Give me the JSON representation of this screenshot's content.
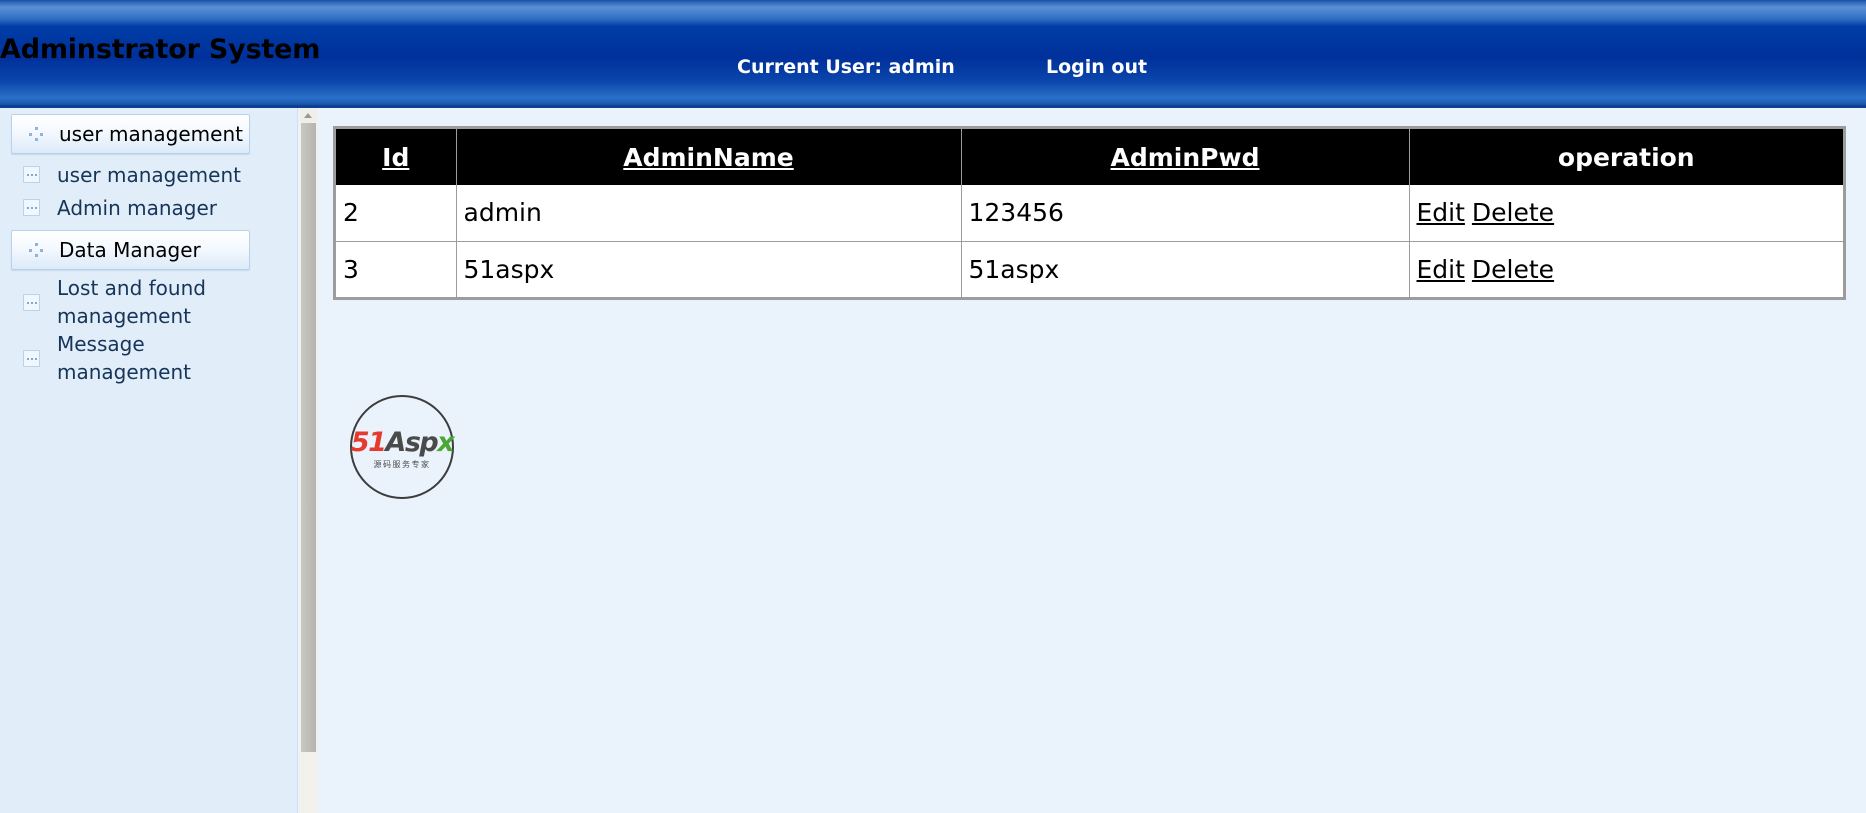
{
  "banner": {
    "title": "Adminstrator System",
    "current_user_label": "Current User:  admin",
    "logout_label": "Login out",
    "gradient_top": "#5a8fd4",
    "gradient_mid": "#00309b",
    "gradient_bottom": "#2a70c8"
  },
  "sidebar": {
    "groups": [
      {
        "label": "user management",
        "icon": "plus-dots-icon",
        "selected": false,
        "items": [
          {
            "label": "user management",
            "icon": "dot-box-icon"
          },
          {
            "label": "Admin manager",
            "icon": "dot-box-icon"
          }
        ]
      },
      {
        "label": "Data Manager",
        "icon": "plus-dots-icon",
        "selected": true,
        "items": [
          {
            "label": "Lost and found management",
            "icon": "dot-box-icon"
          },
          {
            "label": "Message management",
            "icon": "dot-box-icon"
          }
        ]
      }
    ],
    "scrollbar": {
      "up_arrow": "scroll-up-arrow"
    }
  },
  "grid": {
    "columns": [
      {
        "label": "Id",
        "sortable": true
      },
      {
        "label": "AdminName",
        "sortable": true
      },
      {
        "label": "AdminPwd",
        "sortable": true
      },
      {
        "label": "operation",
        "sortable": false
      }
    ],
    "rows": [
      {
        "id": "2",
        "admin_name": "admin",
        "admin_pwd": "123456",
        "edit_label": "Edit",
        "delete_label": "Delete"
      },
      {
        "id": "3",
        "admin_name": "51aspx",
        "admin_pwd": "51aspx",
        "edit_label": "Edit",
        "delete_label": "Delete"
      }
    ]
  },
  "logo": {
    "part_51": "51",
    "part_asp": "Asp",
    "part_x": "x",
    "tagline": "源码服务专家",
    "color_51": "#e8392f",
    "color_asp": "#4a4a4a",
    "color_x": "#4aa832"
  }
}
